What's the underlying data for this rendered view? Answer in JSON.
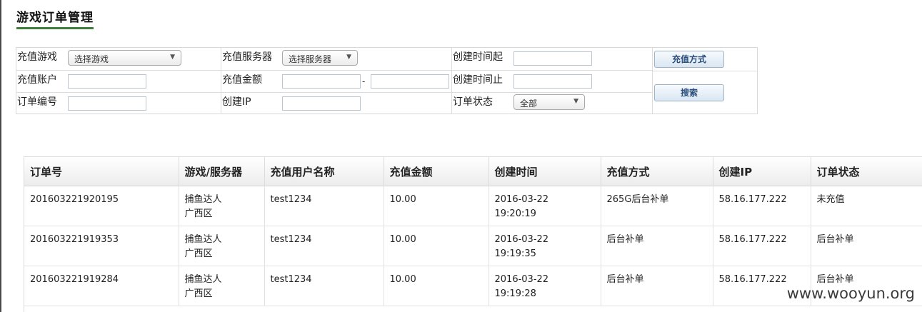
{
  "page": {
    "title": "游戏订单管理",
    "watermark": "www.wooyun.org"
  },
  "filters": {
    "game_label": "充值游戏",
    "game_select": "选择游戏",
    "server_label": "充值服务器",
    "server_select": "选择服务器",
    "created_from_label": "创建时间起",
    "account_label": "充值账户",
    "amount_label": "充值金额",
    "amount_separator": "-",
    "created_to_label": "创建时间止",
    "order_no_label": "订单编号",
    "ip_label": "创建IP",
    "status_label": "订单状态",
    "status_select": "全部",
    "pay_method_button": "充值方式",
    "search_button": "搜索"
  },
  "table": {
    "columns": [
      "订单号",
      "游戏/服务器",
      "充值用户名称",
      "充值金额",
      "创建时间",
      "充值方式",
      "创建IP",
      "订单状态"
    ],
    "rows": [
      {
        "order_no": "201603221920195",
        "game": "捕鱼达人",
        "server": "广西区",
        "user": "test1234",
        "amount": "10.00",
        "date": "2016-03-22",
        "time": "19:20:19",
        "method": "265G后台补单",
        "ip": "58.16.177.222",
        "status": "未充值"
      },
      {
        "order_no": "201603221919353",
        "game": "捕鱼达人",
        "server": "广西区",
        "user": "test1234",
        "amount": "10.00",
        "date": "2016-03-22",
        "time": "19:19:35",
        "method": "后台补单",
        "ip": "58.16.177.222",
        "status": "后台补单"
      },
      {
        "order_no": "201603221919284",
        "game": "捕鱼达人",
        "server": "广西区",
        "user": "test1234",
        "amount": "10.00",
        "date": "2016-03-22",
        "time": "19:19:28",
        "method": "后台补单",
        "ip": "58.16.177.222",
        "status": "后台补单"
      }
    ]
  },
  "colors": {
    "title_underline": "#3e7e3a",
    "button_text": "#2a4d7a"
  }
}
